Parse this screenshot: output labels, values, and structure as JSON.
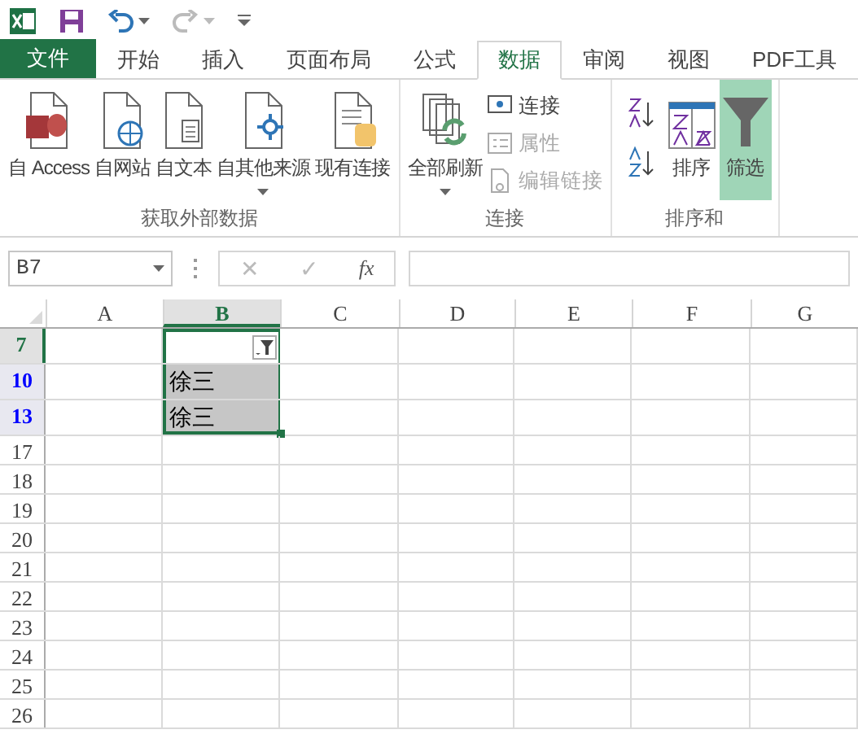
{
  "tabs": [
    {
      "label": "文件",
      "kind": "file",
      "selected": false
    },
    {
      "label": "开始",
      "kind": "tab",
      "selected": false
    },
    {
      "label": "插入",
      "kind": "tab",
      "selected": false
    },
    {
      "label": "页面布局",
      "kind": "tab",
      "selected": false
    },
    {
      "label": "公式",
      "kind": "tab",
      "selected": false
    },
    {
      "label": "数据",
      "kind": "tab",
      "selected": true
    },
    {
      "label": "审阅",
      "kind": "tab",
      "selected": false
    },
    {
      "label": "视图",
      "kind": "tab",
      "selected": false
    },
    {
      "label": "PDF工具",
      "kind": "tab",
      "selected": false
    }
  ],
  "ribbon": {
    "groups": [
      {
        "label": "获取外部数据",
        "buttons": [
          {
            "label": "自 Access",
            "dropdown": false
          },
          {
            "label": "自网站",
            "dropdown": false
          },
          {
            "label": "自文本",
            "dropdown": false
          },
          {
            "label": "自其他来源",
            "dropdown": true
          },
          {
            "label": "现有连接",
            "dropdown": false
          }
        ]
      },
      {
        "label": "连接",
        "buttons": [
          {
            "label": "全部刷新",
            "dropdown": true
          }
        ],
        "small_buttons": [
          {
            "label": "连接",
            "disabled": false
          },
          {
            "label": "属性",
            "disabled": true
          },
          {
            "label": "编辑链接",
            "disabled": true
          }
        ]
      },
      {
        "label": "排序和",
        "buttons": [
          {
            "label": "排序",
            "dropdown": false,
            "selected": false
          },
          {
            "label": "筛选",
            "dropdown": false,
            "selected": true
          }
        ]
      }
    ]
  },
  "formula_bar": {
    "name_box": "B7",
    "cancel": "✕",
    "enter": "✓",
    "function": "fx"
  },
  "columns": [
    {
      "label": "A",
      "selected": false
    },
    {
      "label": "B",
      "selected": true
    },
    {
      "label": "C",
      "selected": false
    },
    {
      "label": "D",
      "selected": false
    },
    {
      "label": "E",
      "selected": false
    },
    {
      "label": "F",
      "selected": false
    },
    {
      "label": "G",
      "selected": false
    }
  ],
  "rows": [
    {
      "label": "7",
      "selected": true,
      "filtered": false,
      "cells": [
        "",
        ""
      ],
      "highlighted": false,
      "filter_button": true
    },
    {
      "label": "10",
      "selected": false,
      "filtered": true,
      "cells": [
        "",
        "徐三"
      ],
      "highlighted": true,
      "filter_button": false
    },
    {
      "label": "13",
      "selected": false,
      "filtered": true,
      "cells": [
        "",
        "徐三"
      ],
      "highlighted": true,
      "filter_button": false
    },
    {
      "label": "17",
      "selected": false,
      "filtered": false,
      "cells": [
        "",
        ""
      ],
      "highlighted": false,
      "filter_button": false
    },
    {
      "label": "18",
      "selected": false,
      "filtered": false,
      "cells": [
        "",
        ""
      ],
      "highlighted": false,
      "filter_button": false
    },
    {
      "label": "19",
      "selected": false,
      "filtered": false,
      "cells": [
        "",
        ""
      ],
      "highlighted": false,
      "filter_button": false
    },
    {
      "label": "20",
      "selected": false,
      "filtered": false,
      "cells": [
        "",
        ""
      ],
      "highlighted": false,
      "filter_button": false
    },
    {
      "label": "21",
      "selected": false,
      "filtered": false,
      "cells": [
        "",
        ""
      ],
      "highlighted": false,
      "filter_button": false
    },
    {
      "label": "22",
      "selected": false,
      "filtered": false,
      "cells": [
        "",
        ""
      ],
      "highlighted": false,
      "filter_button": false
    },
    {
      "label": "23",
      "selected": false,
      "filtered": false,
      "cells": [
        "",
        ""
      ],
      "highlighted": false,
      "filter_button": false
    },
    {
      "label": "24",
      "selected": false,
      "filtered": false,
      "cells": [
        "",
        ""
      ],
      "highlighted": false,
      "filter_button": false
    },
    {
      "label": "25",
      "selected": false,
      "filtered": false,
      "cells": [
        "",
        ""
      ],
      "highlighted": false,
      "filter_button": false
    },
    {
      "label": "26",
      "selected": false,
      "filtered": false,
      "cells": [
        "",
        ""
      ],
      "highlighted": false,
      "filter_button": false
    }
  ]
}
